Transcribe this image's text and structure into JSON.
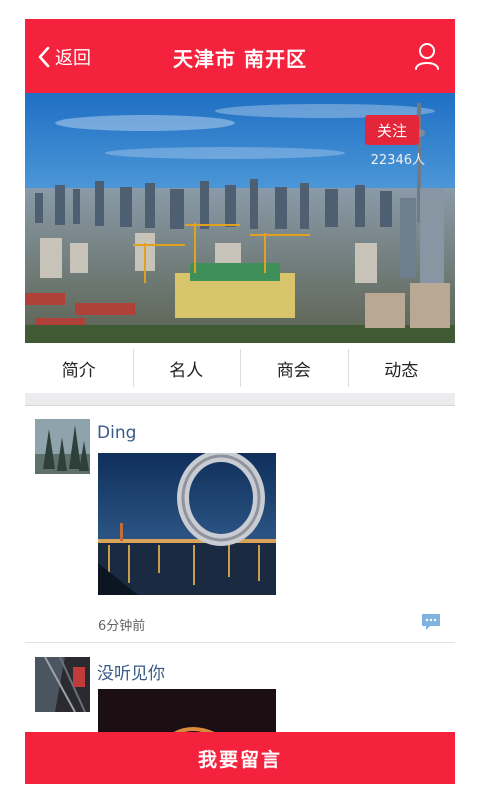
{
  "header": {
    "back_label": "返回",
    "title": "天津市 南开区"
  },
  "hero": {
    "follow_label": "关注",
    "follower_count": "22346人"
  },
  "tabs": [
    {
      "label": "简介"
    },
    {
      "label": "名人"
    },
    {
      "label": "商会"
    },
    {
      "label": "动态"
    }
  ],
  "posts": [
    {
      "username": "Ding",
      "time": "6分钟前"
    },
    {
      "username": "没听见你"
    }
  ],
  "footer": {
    "leave_message_label": "我要留言"
  },
  "colors": {
    "brand_red": "#f5223d",
    "username_blue": "#3a5a8a",
    "comment_icon_blue": "#7fb2e0"
  },
  "icons": {
    "back": "chevron-left-icon",
    "user": "user-profile-icon",
    "comment": "comment-bubble-icon"
  }
}
